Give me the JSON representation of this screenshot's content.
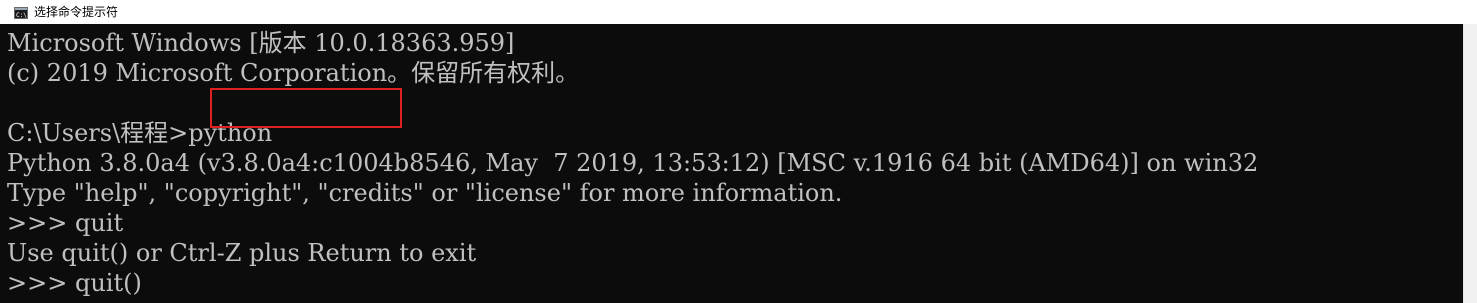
{
  "window": {
    "title": "选择命令提示符",
    "icon": "cmd-icon"
  },
  "console": {
    "lines": [
      "Microsoft Windows [版本 10.0.18363.959]",
      "(c) 2019 Microsoft Corporation。保留所有权利。",
      "",
      "C:\\Users\\程程>python",
      "Python 3.8.0a4 (v3.8.0a4:c1004b8546, May  7 2019, 13:53:12) [MSC v.1916 64 bit (AMD64)] on win32",
      "Type \"help\", \"copyright\", \"credits\" or \"license\" for more information.",
      ">>> quit",
      "Use quit() or Ctrl-Z plus Return to exit",
      ">>> quit()"
    ]
  },
  "colors": {
    "console_bg": "#0c0c0c",
    "console_text": "#c0c0c0",
    "highlight": "#e02020"
  }
}
